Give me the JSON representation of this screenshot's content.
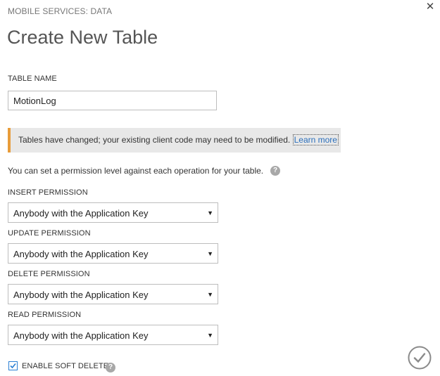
{
  "dialog": {
    "eyebrow": "MOBILE SERVICES: DATA",
    "title": "Create New Table",
    "close_symbol": "✕"
  },
  "table_name": {
    "label": "TABLE NAME",
    "value": "MotionLog"
  },
  "notice": {
    "text": "Tables have changed; your existing client code may need to be modified.",
    "link_label": "Learn more",
    "accent_color": "#e89c3a"
  },
  "permissions": {
    "intro": "You can set a permission level against each operation for your table.",
    "help_symbol": "?",
    "insert": {
      "label": "INSERT PERMISSION",
      "value": "Anybody with the Application Key"
    },
    "update": {
      "label": "UPDATE PERMISSION",
      "value": "Anybody with the Application Key"
    },
    "delete": {
      "label": "DELETE PERMISSION",
      "value": "Anybody with the Application Key"
    },
    "read": {
      "label": "READ PERMISSION",
      "value": "Anybody with the Application Key"
    }
  },
  "soft_delete": {
    "label": "ENABLE SOFT DELETE",
    "checked": true,
    "help_symbol": "?"
  },
  "icons": {
    "close": "close-icon",
    "help": "help-icon",
    "dropdown": "chevron-down-icon",
    "checkmark": "checkmark-icon",
    "confirm": "confirm-check-icon"
  }
}
